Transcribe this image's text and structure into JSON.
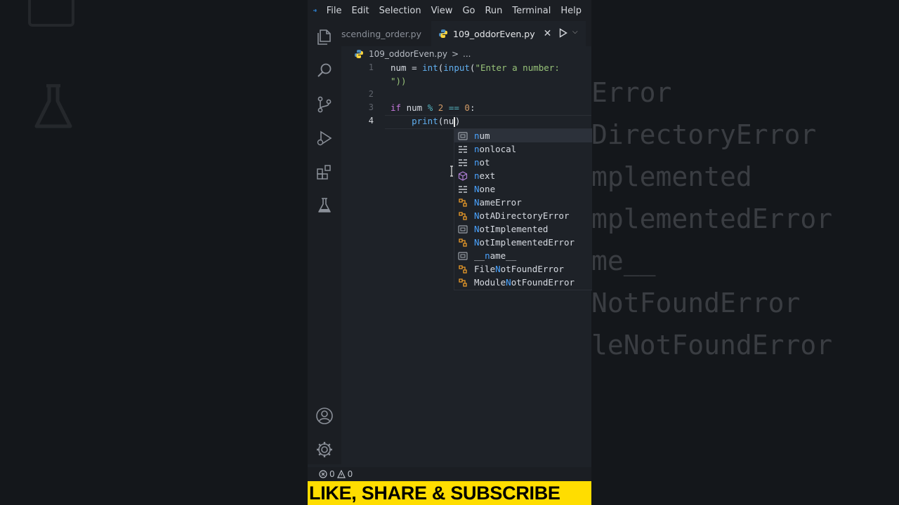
{
  "menu": [
    "File",
    "Edit",
    "Selection",
    "View",
    "Go",
    "Run",
    "Terminal",
    "Help"
  ],
  "tabs": {
    "inactive_label": "scending_order.py",
    "active_label": "109_oddorEven.py",
    "close_glyph": "✕"
  },
  "breadcrumb": {
    "file": "109_oddorEven.py",
    "sep": ">",
    "more": "..."
  },
  "editor": {
    "line_numbers": [
      "1",
      "2",
      "3",
      "4"
    ],
    "code": {
      "l1_a": "num = ",
      "l1_fn1": "int",
      "l1_b": "(",
      "l1_fn2": "input",
      "l1_c": "(",
      "l1_str": "\"Enter a number:",
      "l1_cont": "\"))",
      "l3_kw": "if",
      "l3_a": " num ",
      "l3_op1": "%",
      "l3_sp1": " ",
      "l3_n1": "2",
      "l3_sp2": " ",
      "l3_op2": "==",
      "l3_sp3": " ",
      "l3_n2": "0",
      "l3_colon": ":",
      "l4_indent": "    ",
      "l4_fn": "print",
      "l4_paren": "(",
      "l4_typed": "nu",
      "l4_close": ")"
    }
  },
  "suggestions": [
    {
      "pre": "",
      "match": "n",
      "post": "um",
      "kind": "variable",
      "selected": true
    },
    {
      "pre": "",
      "match": "n",
      "post": "onlocal",
      "kind": "keyword"
    },
    {
      "pre": "",
      "match": "n",
      "post": "ot",
      "kind": "keyword"
    },
    {
      "pre": "",
      "match": "n",
      "post": "ext",
      "kind": "function"
    },
    {
      "pre": "",
      "match": "N",
      "post": "one",
      "kind": "keyword"
    },
    {
      "pre": "",
      "match": "N",
      "post": "ameError",
      "kind": "class"
    },
    {
      "pre": "",
      "match": "N",
      "post": "otADirectoryError",
      "kind": "class"
    },
    {
      "pre": "",
      "match": "N",
      "post": "otImplemented",
      "kind": "variable"
    },
    {
      "pre": "",
      "match": "N",
      "post": "otImplementedError",
      "kind": "class"
    },
    {
      "pre": "__",
      "match": "n",
      "post": "ame__",
      "kind": "variable"
    },
    {
      "pre": "File",
      "match": "N",
      "post": "otFoundError",
      "kind": "class"
    },
    {
      "pre": "Module",
      "match": "N",
      "post": "otFoundError",
      "kind": "class"
    }
  ],
  "status": {
    "errors": "0",
    "warnings": "0"
  },
  "banner": "LIKE, SHARE & SUBSCRIBE",
  "background_ghost": [
    "Error",
    "DirectoryError",
    "mplemented",
    "mplementedError",
    "me__",
    "NotFoundError",
    "leNotFoundError"
  ],
  "colors": {
    "accent": "#4aa3ff",
    "banner_bg": "#ffdd00",
    "editor_bg": "#1e2228"
  },
  "icons": [
    "vscode-logo-icon",
    "explorer-icon",
    "search-icon",
    "source-control-icon",
    "run-debug-icon",
    "extensions-icon",
    "testing-icon",
    "account-icon",
    "settings-gear-icon",
    "python-file-icon",
    "run-play-icon",
    "error-icon",
    "warning-icon"
  ]
}
